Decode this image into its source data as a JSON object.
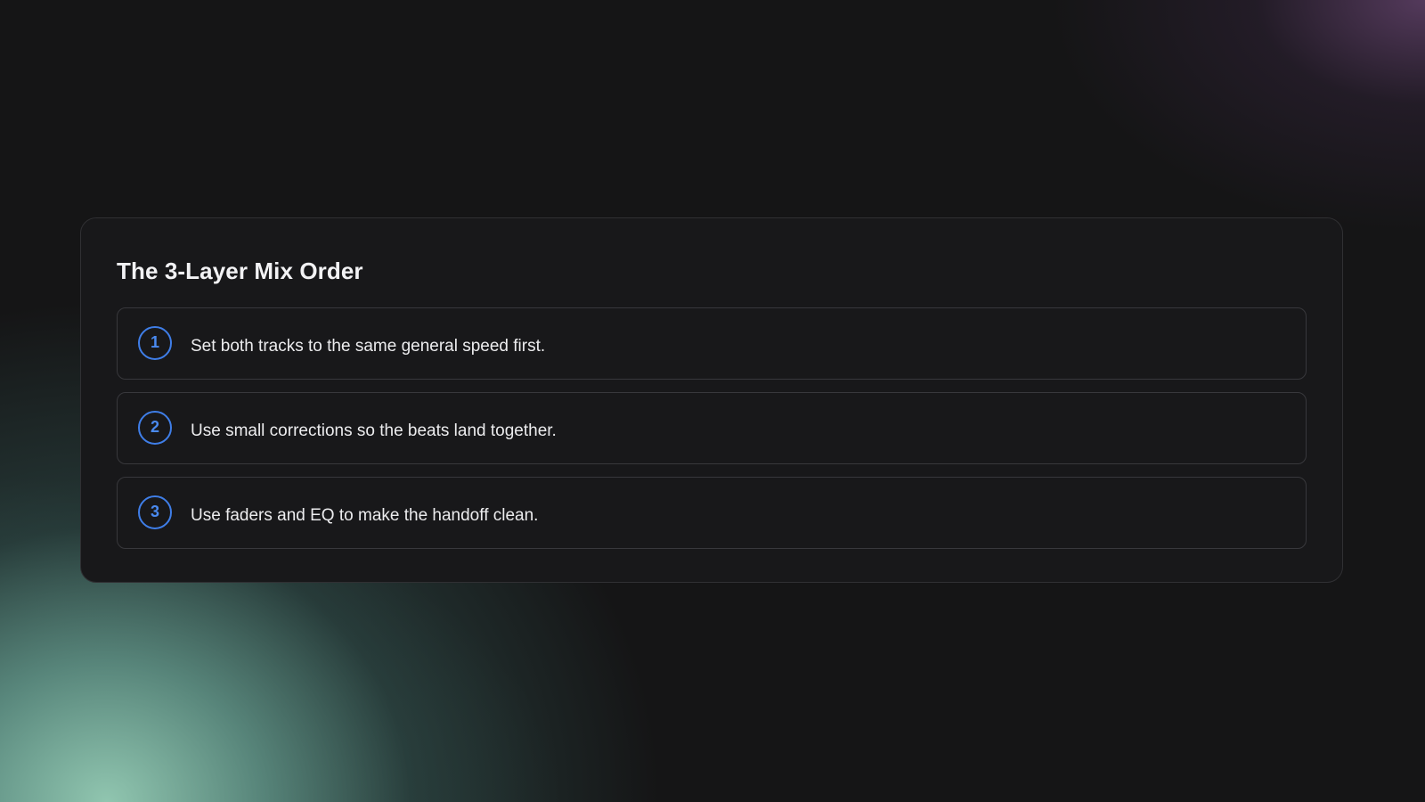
{
  "card": {
    "title": "The 3-Layer Mix Order",
    "steps": [
      {
        "number": "1",
        "text": "Set both tracks to the same general speed first."
      },
      {
        "number": "2",
        "text": "Use small corrections so the beats land together."
      },
      {
        "number": "3",
        "text": "Use faders and EQ to make the handoff clean."
      }
    ]
  },
  "colors": {
    "background": "#151516",
    "card_background": "#18181a",
    "accent_blue": "#3f7ee8",
    "glow_teal": "#96cdb6",
    "glow_purple": "#694673"
  }
}
